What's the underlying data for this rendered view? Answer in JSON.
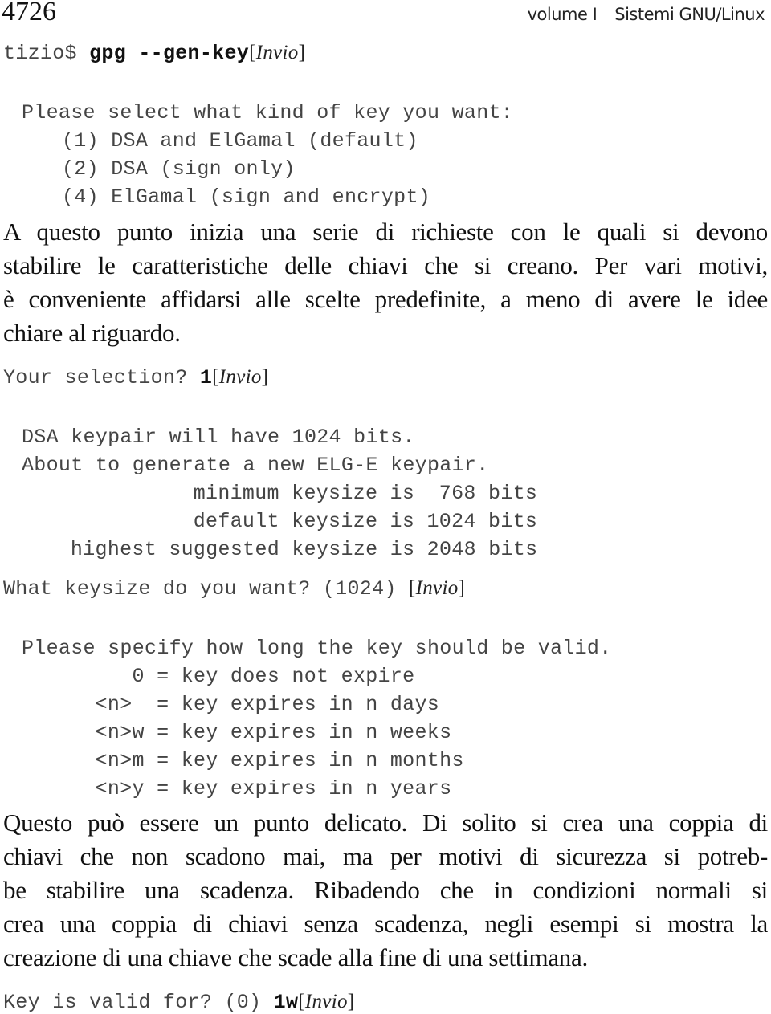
{
  "header": {
    "page_number": "4726",
    "volume": "volume I",
    "title": "Sistemi GNU/Linux"
  },
  "enter_key": "Invio",
  "command": {
    "prompt": "tizio$ ",
    "input": "gpg --gen-key"
  },
  "key_kind": {
    "question": "Please select what kind of key you want:",
    "options": [
      "(1) DSA and ElGamal (default)",
      "(2) DSA (sign only)",
      "(4) ElGamal (sign and encrypt)"
    ]
  },
  "paragraph1": {
    "lines": [
      "A questo punto inizia una serie di richieste con le quali si devono",
      "stabilire le caratteristiche delle chiavi che si creano. Per vari motivi,",
      "è conveniente affidarsi alle scelte predefinite, a meno di avere le idee",
      "chiare al riguardo."
    ]
  },
  "selection": {
    "prompt": "Your selection? ",
    "input": "1"
  },
  "keypair_info": {
    "lines": [
      "DSA keypair will have 1024 bits.",
      "About to generate a new ELG-E keypair.",
      "         minimum keysize is  768 bits",
      "         default keysize is 1024 bits",
      "   highest suggested keysize is 2048 bits"
    ]
  },
  "keysize": {
    "prompt": "What keysize do you want? (1024) "
  },
  "validity": {
    "question": "Please specify how long the key should be valid.",
    "options": [
      "     0 = key does not expire",
      "  <n>  = key expires in n days",
      "  <n>w = key expires in n weeks",
      "  <n>m = key expires in n months",
      "  <n>y = key expires in n years"
    ]
  },
  "paragraph2": {
    "lines": [
      "Questo può essere un punto delicato. Di solito si crea una coppia di",
      "chiavi che non scadono mai, ma per motivi di sicurezza si potreb-",
      "be stabilire una scadenza. Ribadendo che in condizioni normali si",
      "crea una coppia di chiavi senza scadenza, negli esempi si mostra la",
      "creazione di una chiave che scade alla fine di una settimana."
    ]
  },
  "valid_for": {
    "prompt": "Key is valid for? (0) ",
    "input": "1w"
  }
}
